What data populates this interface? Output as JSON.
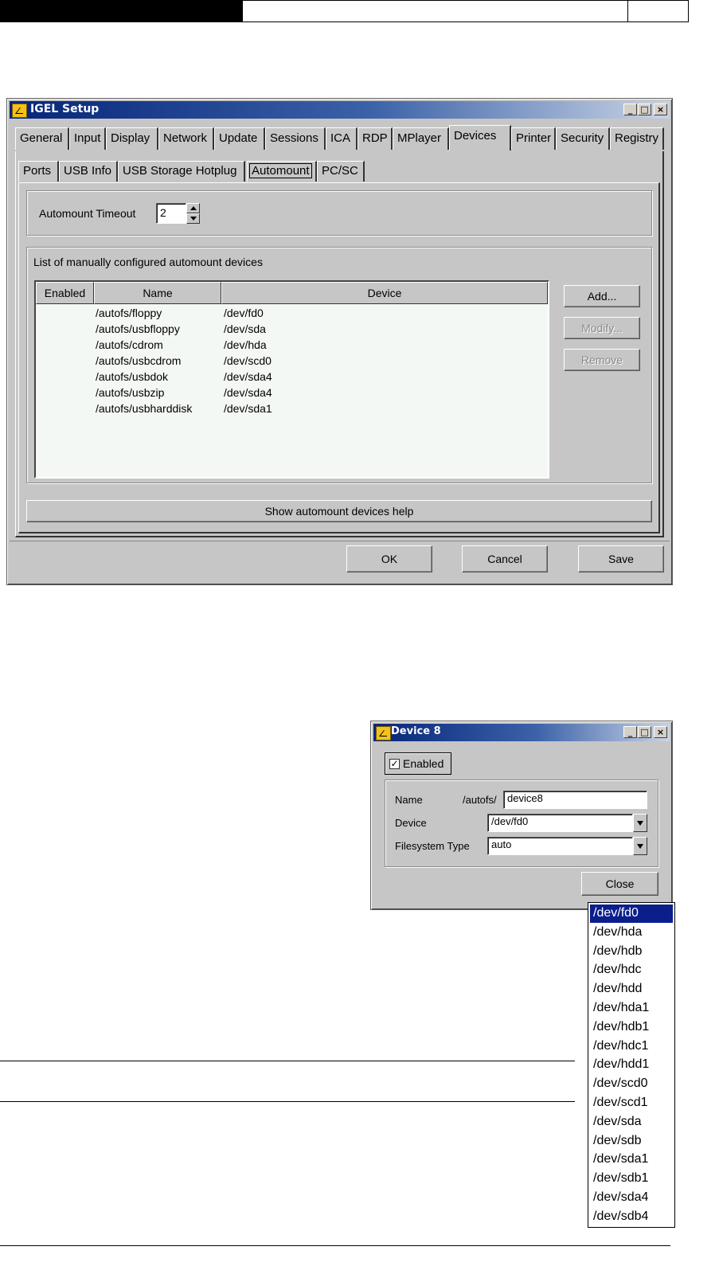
{
  "colors": {
    "titlebar": "#06257a",
    "window_bg": "#c6c6c6",
    "selection": "#0a1e8c",
    "list_bg": "#f4f8f4"
  },
  "main_window": {
    "title": "IGEL Setup",
    "title_buttons": {
      "minimize": "_",
      "maximize": "□",
      "close": "×"
    },
    "tabs": [
      "General",
      "Input",
      "Display",
      "Network",
      "Update",
      "Sessions",
      "ICA",
      "RDP",
      "MPlayer",
      "Devices",
      "Printer",
      "Security",
      "Registry"
    ],
    "active_tab": "Devices",
    "subtabs": [
      "Ports",
      "USB Info",
      "USB Storage Hotplug",
      "Automount",
      "PC/SC"
    ],
    "active_subtab": "Automount",
    "timeout_label": "Automount Timeout",
    "timeout_value": "2",
    "list_title": "List of manually configured automount devices",
    "columns": [
      "Enabled",
      "Name",
      "Device"
    ],
    "rows": [
      {
        "enabled": "",
        "name": "/autofs/floppy",
        "device": "/dev/fd0"
      },
      {
        "enabled": "",
        "name": "/autofs/usbfloppy",
        "device": "/dev/sda"
      },
      {
        "enabled": "",
        "name": "/autofs/cdrom",
        "device": "/dev/hda"
      },
      {
        "enabled": "",
        "name": "/autofs/usbcdrom",
        "device": "/dev/scd0"
      },
      {
        "enabled": "",
        "name": "/autofs/usbdok",
        "device": "/dev/sda4"
      },
      {
        "enabled": "",
        "name": "/autofs/usbzip",
        "device": "/dev/sda4"
      },
      {
        "enabled": "",
        "name": "/autofs/usbharddisk",
        "device": "/dev/sda1"
      }
    ],
    "buttons": {
      "add": "Add...",
      "modify": "Modify...",
      "remove": "Remove"
    },
    "help_button": "Show automount devices help",
    "ok": "OK",
    "cancel": "Cancel",
    "save": "Save"
  },
  "device_dialog": {
    "title": "Device 8",
    "title_buttons": {
      "minimize": "_",
      "maximize": "□",
      "close": "×"
    },
    "enabled_label": "Enabled",
    "enabled_checked": true,
    "name_label": "Name",
    "name_prefix": "/autofs/",
    "name_value": "device8",
    "device_label": "Device",
    "device_value": "/dev/fd0",
    "fs_label": "Filesystem Type",
    "fs_value": "auto",
    "close": "Close"
  },
  "device_dropdown": {
    "selected": "/dev/fd0",
    "options": [
      "/dev/fd0",
      "/dev/hda",
      "/dev/hdb",
      "/dev/hdc",
      "/dev/hdd",
      "/dev/hda1",
      "/dev/hdb1",
      "/dev/hdc1",
      "/dev/hdd1",
      "/dev/scd0",
      "/dev/scd1",
      "/dev/sda",
      "/dev/sdb",
      "/dev/sda1",
      "/dev/sdb1",
      "/dev/sda4",
      "/dev/sdb4"
    ]
  }
}
